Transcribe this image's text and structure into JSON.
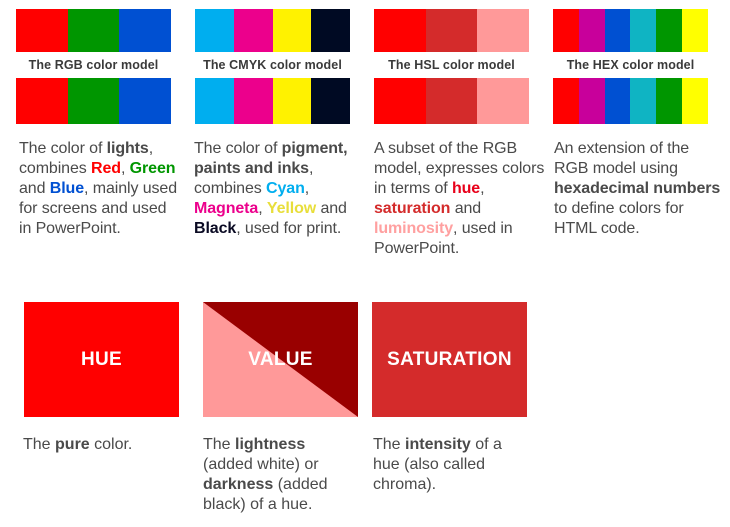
{
  "models": [
    {
      "id": "rgb",
      "label": "The RGB color model",
      "swatches": [
        "#ff0000",
        "#009600",
        "#0050d2"
      ]
    },
    {
      "id": "cmyk",
      "label": "The CMYK color model",
      "swatches": [
        "#00aeef",
        "#ec008c",
        "#fff200",
        "#000a23"
      ]
    },
    {
      "id": "hsl",
      "label": "The HSL color model",
      "swatches": [
        "#ff0000",
        "#d42b2b",
        "#ff9999"
      ]
    },
    {
      "id": "hex",
      "label": "The HEX color model",
      "swatches": [
        "#ff0000",
        "#c8009b",
        "#0050d2",
        "#0fb4c3",
        "#009600",
        "#ffff00"
      ]
    }
  ],
  "descriptions": {
    "rgb": [
      {
        "t": "The color of "
      },
      {
        "t": "lights",
        "b": true
      },
      {
        "t": ", combines "
      },
      {
        "t": "Red",
        "b": true,
        "c": "#ff0000"
      },
      {
        "t": ", "
      },
      {
        "t": "Green",
        "b": true,
        "c": "#009600"
      },
      {
        "t": " and "
      },
      {
        "t": "Blue",
        "b": true,
        "c": "#0050d2"
      },
      {
        "t": ", mainly used for screens and used in PowerPoint."
      }
    ],
    "cmyk": [
      {
        "t": "The color of "
      },
      {
        "t": "pigment, paints and inks",
        "b": true
      },
      {
        "t": ", combines "
      },
      {
        "t": "Cyan",
        "b": true,
        "c": "#00aeef"
      },
      {
        "t": ", "
      },
      {
        "t": "Magneta",
        "b": true,
        "c": "#ec008c"
      },
      {
        "t": ", "
      },
      {
        "t": "Yellow",
        "b": true,
        "c": "#e8de3a"
      },
      {
        "t": " and "
      },
      {
        "t": "Black",
        "b": true,
        "c": "#0a0a23"
      },
      {
        "t": ", used for print."
      }
    ],
    "hsl": [
      {
        "t": "A subset of the RGB model, expresses colors in terms of "
      },
      {
        "t": "hue",
        "b": true,
        "c": "#e8001a"
      },
      {
        "t": ", "
      },
      {
        "t": "saturation",
        "b": true,
        "c": "#d42b2b"
      },
      {
        "t": " and "
      },
      {
        "t": "luminosity",
        "b": true,
        "c": "#ffa0a0"
      },
      {
        "t": ", used in PowerPoint."
      }
    ],
    "hex": [
      {
        "t": "An extension of the RGB model using "
      },
      {
        "t": "hexadecimal numbers",
        "b": true
      },
      {
        "t": " to define colors for HTML code."
      }
    ]
  },
  "cards": [
    {
      "id": "hue",
      "label": "HUE",
      "color": "#ff0000",
      "desc": [
        {
          "t": "The "
        },
        {
          "t": "pure",
          "b": true
        },
        {
          "t": " color."
        }
      ]
    },
    {
      "id": "value",
      "label": "VALUE",
      "color_light": "#ff9999",
      "color_dark": "#990000",
      "desc": [
        {
          "t": "The "
        },
        {
          "t": "lightness",
          "b": true
        },
        {
          "t": " (added white) or "
        },
        {
          "t": "darkness",
          "b": true
        },
        {
          "t": " (added black) of a hue."
        }
      ]
    },
    {
      "id": "saturation",
      "label": "SATURATION",
      "color": "#d42b2b",
      "desc": [
        {
          "t": "The "
        },
        {
          "t": "intensity",
          "b": true
        },
        {
          "t": " of a hue (also called chroma)."
        }
      ]
    }
  ]
}
